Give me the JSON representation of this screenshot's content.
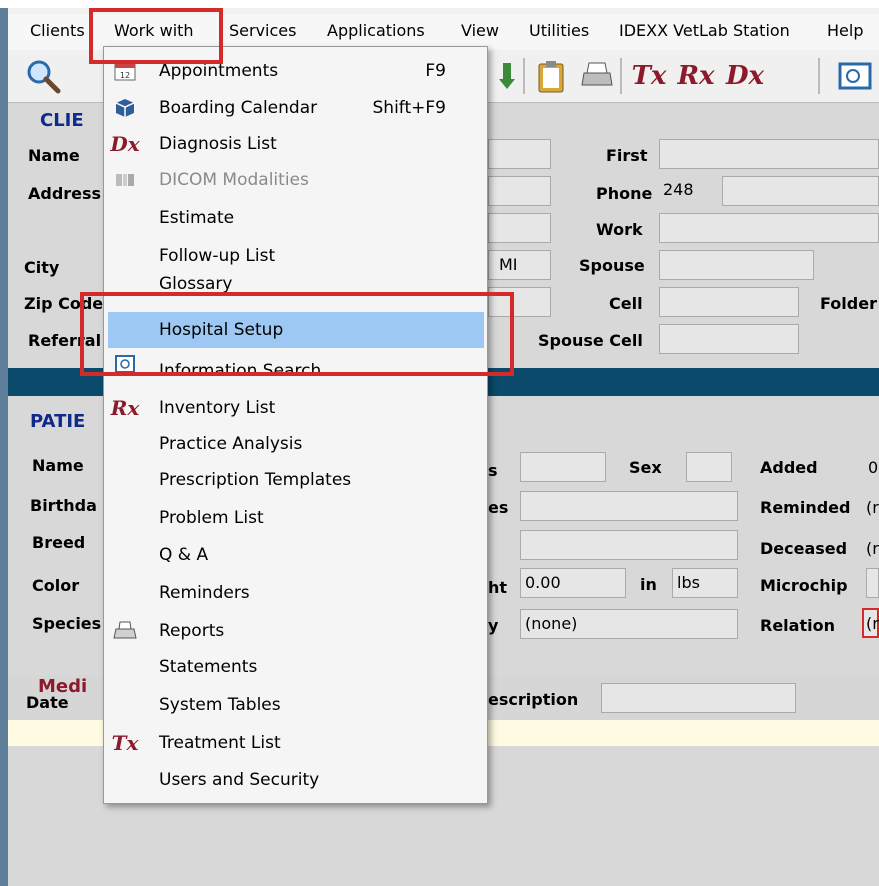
{
  "menubar": {
    "items": [
      "Clients",
      "Work with",
      "Services",
      "Applications",
      "View",
      "Utilities",
      "IDEXX VetLab Station",
      "Help"
    ]
  },
  "toolbar": {
    "tx": "Tx",
    "rx": "Rx",
    "dx": "Dx"
  },
  "client": {
    "title": "CLIE",
    "labels": {
      "name": "Name",
      "address": "Address",
      "city": "City",
      "zip": "Zip Code",
      "referral": "Referral",
      "first": "First",
      "phone": "Phone",
      "work": "Work",
      "spouse": "Spouse",
      "cell": "Cell",
      "folder": "Folder",
      "spouse_cell": "Spouse Cell"
    },
    "values": {
      "state": "MI",
      "phone_area": "248"
    }
  },
  "patient": {
    "title": "PATIE",
    "labels": {
      "name": "Name",
      "birthday": "Birthda",
      "breed": "Breed",
      "color": "Color",
      "species": "Species",
      "sex": "Sex",
      "added": "Added",
      "reminded": "Reminded",
      "deceased": "Deceased",
      "microchip": "Microchip",
      "relation": "Relation",
      "weight_tail": "ht",
      "in": "in",
      "unit": "lbs",
      "status_tail": "s",
      "es_tail": "es",
      "y_tail": "y"
    },
    "values": {
      "weight": "0.00",
      "allergy": "(none)",
      "added_cut": "0",
      "reminded_cut": "(r",
      "deceased_cut": "(r",
      "relation_cut": "(r"
    }
  },
  "medical": {
    "title": "Medi",
    "labels": {
      "date": "Date",
      "description": "escription"
    }
  },
  "dropdown": {
    "items": [
      {
        "label": "Appointments",
        "shortcut": "F9",
        "icon": "calendar-icon"
      },
      {
        "label": "Boarding Calendar",
        "shortcut": "Shift+F9",
        "icon": "box-icon"
      },
      {
        "label": "Diagnosis List",
        "shortcut": "",
        "icon": "dx-icon",
        "glyph": "Dx"
      },
      {
        "label": "DICOM Modalities",
        "shortcut": "",
        "icon": "dicom-icon",
        "disabled": true
      },
      {
        "label": "Estimate",
        "shortcut": ""
      },
      {
        "label": "Follow-up List",
        "shortcut": ""
      },
      {
        "label": "Glossary",
        "shortcut": ""
      },
      {
        "label": "Hospital Setup",
        "shortcut": "",
        "highlighted": true
      },
      {
        "label": "Information Search",
        "shortcut": "",
        "icon": "search-window-icon"
      },
      {
        "label": "Inventory List",
        "shortcut": "",
        "icon": "rx-icon",
        "glyph": "Rx"
      },
      {
        "label": "Practice Analysis",
        "shortcut": ""
      },
      {
        "label": "Prescription Templates",
        "shortcut": ""
      },
      {
        "label": "Problem List",
        "shortcut": ""
      },
      {
        "label": "Q & A",
        "shortcut": ""
      },
      {
        "label": "Reminders",
        "shortcut": ""
      },
      {
        "label": "Reports",
        "shortcut": "",
        "icon": "printer-icon"
      },
      {
        "label": "Statements",
        "shortcut": ""
      },
      {
        "label": "System Tables",
        "shortcut": ""
      },
      {
        "label": "Treatment List",
        "shortcut": "",
        "icon": "tx-icon",
        "glyph": "Tx"
      },
      {
        "label": "Users and Security",
        "shortcut": ""
      }
    ]
  },
  "colors": {
    "highlight": "#9cc8f3",
    "annotation_red": "#d42a2a",
    "band": "#0b4a6a",
    "section_title": "#102a8a",
    "med_title": "#8b1a2a"
  }
}
